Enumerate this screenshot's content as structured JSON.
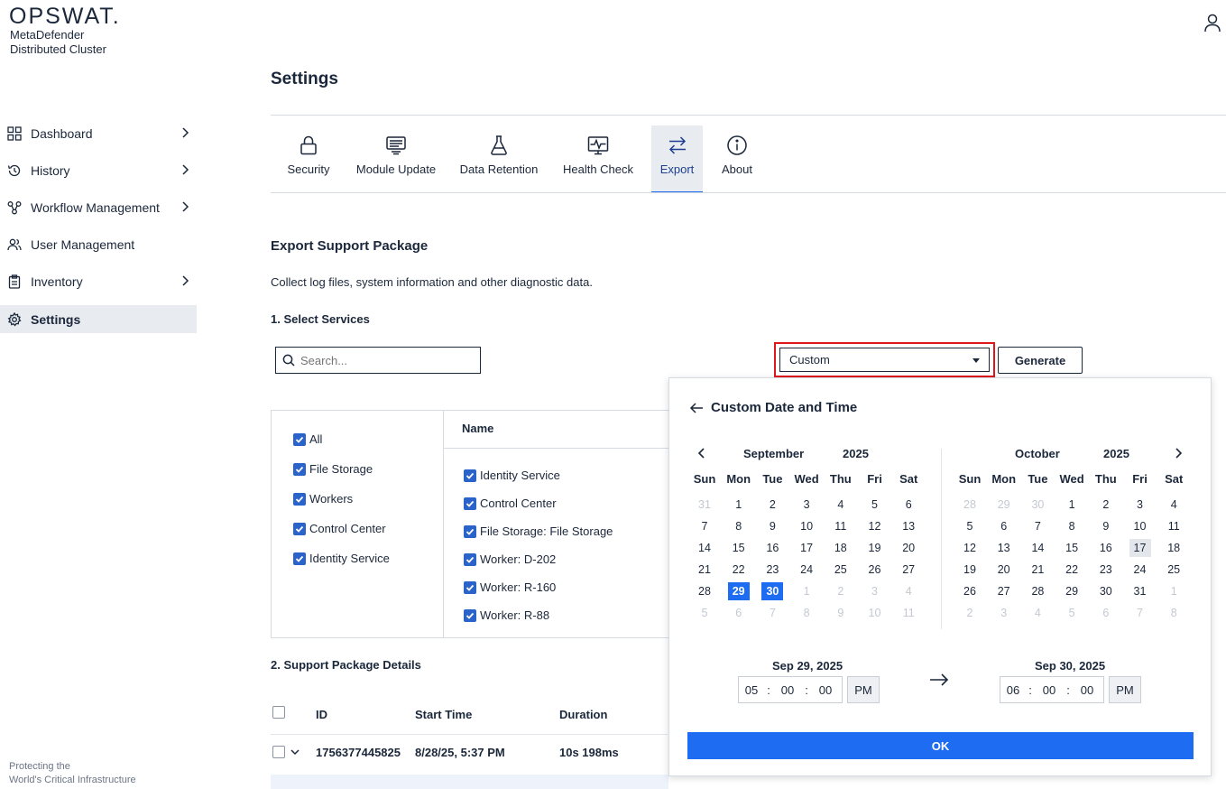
{
  "brand": {
    "logo": "OPSWAT.",
    "product_line1": "MetaDefender",
    "product_line2": "Distributed Cluster",
    "footer_line1": "Protecting the",
    "footer_line2": "World's Critical Infrastructure"
  },
  "sidebar": {
    "items": [
      {
        "label": "Dashboard",
        "icon": "grid-icon",
        "has_submenu": true
      },
      {
        "label": "History",
        "icon": "history-icon",
        "has_submenu": true
      },
      {
        "label": "Workflow Management",
        "icon": "workflow-icon",
        "has_submenu": true
      },
      {
        "label": "User Management",
        "icon": "users-icon",
        "has_submenu": false
      },
      {
        "label": "Inventory",
        "icon": "clipboard-icon",
        "has_submenu": true
      },
      {
        "label": "Settings",
        "icon": "gear-icon",
        "has_submenu": false,
        "active": true
      }
    ]
  },
  "header": {
    "title": "Settings",
    "user_icon": "user-icon"
  },
  "tabs": [
    {
      "label": "Security",
      "icon": "lock-icon"
    },
    {
      "label": "Module Update",
      "icon": "module-icon"
    },
    {
      "label": "Data Retention",
      "icon": "flask-icon"
    },
    {
      "label": "Health Check",
      "icon": "monitor-pulse-icon"
    },
    {
      "label": "Export",
      "icon": "arrows-exchange-icon",
      "active": true
    },
    {
      "label": "About",
      "icon": "info-icon"
    }
  ],
  "export": {
    "section_title": "Export Support Package",
    "description": "Collect log files, system information and other diagnostic data.",
    "step1": "1. Select Services",
    "search_placeholder": "Search...",
    "range_select": "Custom",
    "generate_label": "Generate",
    "name_header": "Name",
    "groups": [
      {
        "label": "All",
        "checked": true
      },
      {
        "label": "File Storage",
        "checked": true
      },
      {
        "label": "Workers",
        "checked": true
      },
      {
        "label": "Control Center",
        "checked": true
      },
      {
        "label": "Identity Service",
        "checked": true
      }
    ],
    "services": [
      {
        "label": "Identity Service",
        "checked": true
      },
      {
        "label": "Control Center",
        "checked": true
      },
      {
        "label": "File Storage: File Storage",
        "checked": true
      },
      {
        "label": "Worker: D-202",
        "checked": true
      },
      {
        "label": "Worker: R-160",
        "checked": true
      },
      {
        "label": "Worker: R-88",
        "checked": true
      }
    ],
    "step2": "2. Support Package Details",
    "table": {
      "headers": [
        "ID",
        "Start Time",
        "Duration"
      ],
      "rows": [
        {
          "id": "1756377445825",
          "start": "8/28/25, 5:37 PM",
          "duration": "10s 198ms"
        }
      ]
    }
  },
  "picker": {
    "title": "Custom Date and Time",
    "weekdays": [
      "Sun",
      "Mon",
      "Tue",
      "Wed",
      "Thu",
      "Fri",
      "Sat"
    ],
    "left": {
      "month": "September",
      "year": "2025",
      "weeks": [
        [
          [
            "31",
            1
          ],
          [
            "1",
            0
          ],
          [
            "2",
            0
          ],
          [
            "3",
            0
          ],
          [
            "4",
            0
          ],
          [
            "5",
            0
          ],
          [
            "6",
            0
          ]
        ],
        [
          [
            "7",
            0
          ],
          [
            "8",
            0
          ],
          [
            "9",
            0
          ],
          [
            "10",
            0
          ],
          [
            "11",
            0
          ],
          [
            "12",
            0
          ],
          [
            "13",
            0
          ]
        ],
        [
          [
            "14",
            0
          ],
          [
            "15",
            0
          ],
          [
            "16",
            0
          ],
          [
            "17",
            0
          ],
          [
            "18",
            0
          ],
          [
            "19",
            0
          ],
          [
            "20",
            0
          ]
        ],
        [
          [
            "21",
            0
          ],
          [
            "22",
            0
          ],
          [
            "23",
            0
          ],
          [
            "24",
            0
          ],
          [
            "25",
            0
          ],
          [
            "26",
            0
          ],
          [
            "27",
            0
          ]
        ],
        [
          [
            "28",
            0
          ],
          [
            "29",
            2
          ],
          [
            "30",
            2
          ],
          [
            "1",
            1
          ],
          [
            "2",
            1
          ],
          [
            "3",
            1
          ],
          [
            "4",
            1
          ]
        ],
        [
          [
            "5",
            1
          ],
          [
            "6",
            1
          ],
          [
            "7",
            1
          ],
          [
            "8",
            1
          ],
          [
            "9",
            1
          ],
          [
            "10",
            1
          ],
          [
            "11",
            1
          ]
        ]
      ]
    },
    "right": {
      "month": "October",
      "year": "2025",
      "weeks": [
        [
          [
            "28",
            1
          ],
          [
            "29",
            1
          ],
          [
            "30",
            1
          ],
          [
            "1",
            0
          ],
          [
            "2",
            0
          ],
          [
            "3",
            0
          ],
          [
            "4",
            0
          ]
        ],
        [
          [
            "5",
            0
          ],
          [
            "6",
            0
          ],
          [
            "7",
            0
          ],
          [
            "8",
            0
          ],
          [
            "9",
            0
          ],
          [
            "10",
            0
          ],
          [
            "11",
            0
          ]
        ],
        [
          [
            "12",
            0
          ],
          [
            "13",
            0
          ],
          [
            "14",
            0
          ],
          [
            "15",
            0
          ],
          [
            "16",
            0
          ],
          [
            "17",
            3
          ],
          [
            "18",
            0
          ]
        ],
        [
          [
            "19",
            0
          ],
          [
            "20",
            0
          ],
          [
            "21",
            0
          ],
          [
            "22",
            0
          ],
          [
            "23",
            0
          ],
          [
            "24",
            0
          ],
          [
            "25",
            0
          ]
        ],
        [
          [
            "26",
            0
          ],
          [
            "27",
            0
          ],
          [
            "28",
            0
          ],
          [
            "29",
            0
          ],
          [
            "30",
            0
          ],
          [
            "31",
            0
          ],
          [
            "1",
            1
          ]
        ],
        [
          [
            "2",
            1
          ],
          [
            "3",
            1
          ],
          [
            "4",
            1
          ],
          [
            "5",
            1
          ],
          [
            "6",
            1
          ],
          [
            "7",
            1
          ],
          [
            "8",
            1
          ]
        ]
      ]
    },
    "start": {
      "date": "Sep 29, 2025",
      "hh": "05",
      "mm": "00",
      "ss": "00",
      "ampm": "PM"
    },
    "end": {
      "date": "Sep 30, 2025",
      "hh": "06",
      "mm": "00",
      "ss": "00",
      "ampm": "PM"
    },
    "ok_label": "OK",
    "colors": {
      "accent": "#1d6cf2",
      "highlight_border": "#e0161e"
    }
  }
}
